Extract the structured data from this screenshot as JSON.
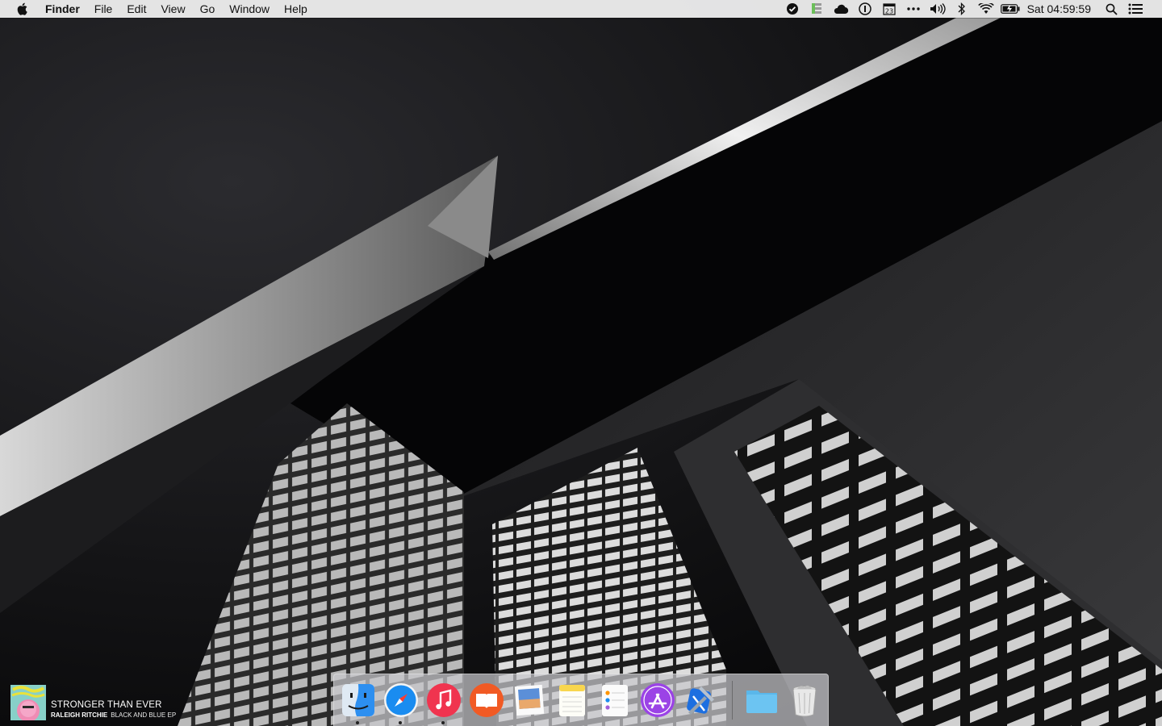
{
  "menubar": {
    "apple_icon": "apple-logo",
    "app_name": "Finder",
    "menus": [
      "File",
      "Edit",
      "View",
      "Go",
      "Window",
      "Help"
    ],
    "clock": "Sat 04:59:59",
    "calendar_day": "23",
    "status_icons": [
      "checkmark-circle-icon",
      "stack-icon",
      "cloud-icon",
      "one-password-icon",
      "calendar-icon",
      "ellipsis-icon",
      "volume-icon",
      "bluetooth-icon",
      "wifi-icon",
      "battery-charging-icon",
      "spotlight-search-icon",
      "notification-center-icon"
    ]
  },
  "now_playing": {
    "title": "STRONGER THAN EVER",
    "artist": "RALEIGH RITCHIE",
    "album": "BLACK AND BLUE EP"
  },
  "dock": {
    "items": [
      {
        "name": "Finder",
        "icon": "finder-icon",
        "running": true
      },
      {
        "name": "Safari",
        "icon": "safari-icon",
        "running": true
      },
      {
        "name": "iTunes",
        "icon": "itunes-icon",
        "running": true
      },
      {
        "name": "iBooks",
        "icon": "ibooks-icon",
        "running": false
      },
      {
        "name": "Preview",
        "icon": "preview-icon",
        "running": false
      },
      {
        "name": "Notes",
        "icon": "notes-icon",
        "running": false
      },
      {
        "name": "Reminders",
        "icon": "reminders-icon",
        "running": false
      },
      {
        "name": "App Store",
        "icon": "app-store-icon",
        "running": false
      },
      {
        "name": "Xcode",
        "icon": "xcode-icon",
        "running": false
      },
      {
        "name": "Downloads",
        "icon": "folder-icon",
        "running": false
      },
      {
        "name": "Trash",
        "icon": "trash-icon",
        "running": false
      }
    ]
  },
  "colors": {
    "menubar_bg": "#ececec",
    "itunes_red": "#f0344f",
    "ibooks_orange": "#f15a24",
    "safari_blue": "#1a8cf0",
    "app_store_purple": "#9b43e6",
    "folder_blue": "#6cc4f2"
  }
}
